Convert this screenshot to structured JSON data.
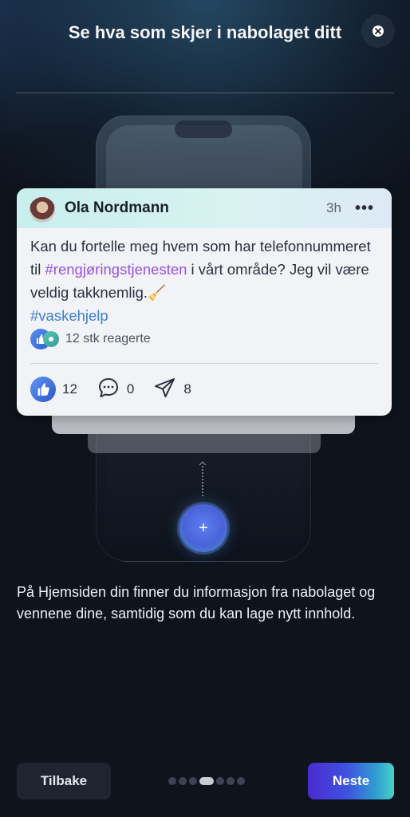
{
  "header": {
    "title": "Se hva som skjer i nabolaget ditt",
    "close_icon": "close-icon"
  },
  "post": {
    "author": "Ola Nordmann",
    "time": "3h",
    "more": "•••",
    "text_before": "Kan du fortelle meg hvem som har telefonnummeret til ",
    "hashtag": "#rengjøringstjenesten",
    "text_after": " i vårt område? Jeg vil være veldig takknemlig.🧹",
    "hashtag2": "#vaskehjelp",
    "reacted_text": "12 stk reagerte",
    "like_count": "12",
    "comment_count": "0",
    "share_count": "8"
  },
  "fab": {
    "label": "+"
  },
  "description": "På Hjemsiden din finner du informasjon fra nabolaget og vennene dine, samtidig som du kan lage nytt innhold.",
  "footer": {
    "back_label": "Tilbake",
    "next_label": "Neste",
    "page_count": 7,
    "active_page": 4
  },
  "colors": {
    "hashtag": "#9a52e0",
    "hashtag2": "#3f7fd0",
    "accent": "#4b2ad0",
    "background": "#0e131c"
  }
}
